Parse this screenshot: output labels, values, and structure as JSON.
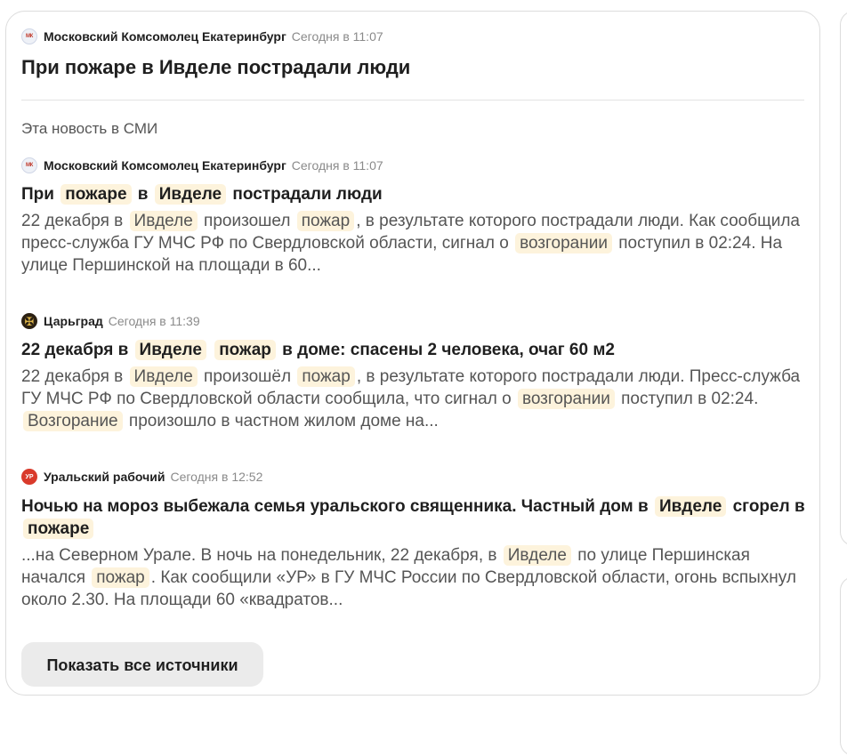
{
  "header": {
    "source_name": "Московский Комсомолец Екатеринбург",
    "time": "Сегодня в 11:07",
    "logo_text": "МК",
    "title": "При пожаре в Ивделе пострадали люди"
  },
  "section_label": "Эта новость в СМИ",
  "items": [
    {
      "source_name": "Московский Комсомолец Екатеринбург",
      "time": "Сегодня в 11:07",
      "logo_text": "МК",
      "title": [
        {
          "t": "При "
        },
        {
          "t": "пожаре",
          "hl": true
        },
        {
          "t": " в "
        },
        {
          "t": "Ивделе",
          "hl": true
        },
        {
          "t": " пострадали люди"
        }
      ],
      "snippet": [
        {
          "t": "22 декабря в "
        },
        {
          "t": "Ивделе",
          "hl": true
        },
        {
          "t": " произошел "
        },
        {
          "t": "пожар",
          "hl": true
        },
        {
          "t": ", в результате которого пострадали люди. Как сообщила пресс-служба ГУ МЧС РФ по Свердловской области, сигнал о "
        },
        {
          "t": "возгорании",
          "hl": true
        },
        {
          "t": " поступил в 02:24. На улице Першинской на площади в 60..."
        }
      ]
    },
    {
      "source_name": "Царьград",
      "time": "Сегодня в 11:39",
      "logo_text": "✠",
      "title": [
        {
          "t": "22 декабря в "
        },
        {
          "t": "Ивделе",
          "hl": true
        },
        {
          "t": " "
        },
        {
          "t": "пожар",
          "hl": true
        },
        {
          "t": " в доме: спасены 2 человека, очаг 60 м2"
        }
      ],
      "snippet": [
        {
          "t": "22 декабря в "
        },
        {
          "t": "Ивделе",
          "hl": true
        },
        {
          "t": " произошёл "
        },
        {
          "t": "пожар",
          "hl": true
        },
        {
          "t": ", в результате которого пострадали люди. Пресс-служба ГУ МЧС РФ по Свердловской области сообщила, что сигнал о "
        },
        {
          "t": "возгорании",
          "hl": true
        },
        {
          "t": " поступил в 02:24. "
        },
        {
          "t": "Возгорание",
          "hl": true
        },
        {
          "t": " произошло в частном жилом доме на..."
        }
      ]
    },
    {
      "source_name": "Уральский рабочий",
      "time": "Сегодня в 12:52",
      "logo_text": "УР",
      "title": [
        {
          "t": "Ночью на мороз выбежала семья уральского священника. Частный дом в "
        },
        {
          "t": "Ивделе",
          "hl": true
        },
        {
          "t": " сгорел в "
        },
        {
          "t": "пожаре",
          "hl": true
        }
      ],
      "snippet": [
        {
          "t": "...на Северном Урале. В ночь на понедельник, 22 декабря, в "
        },
        {
          "t": "Ивделе",
          "hl": true
        },
        {
          "t": " по улице Першинская начался "
        },
        {
          "t": "пожар",
          "hl": true
        },
        {
          "t": ". Как сообщили «УР» в ГУ МЧС России по Свердловской области, огонь вспыхнул около 2.30. На площади 60 «квадратов..."
        }
      ]
    }
  ],
  "show_all_button": "Показать все источники",
  "colors": {
    "highlight_bg": "#fdf3dc",
    "button_bg": "#ebebeb",
    "muted_text": "#8a8a8a",
    "snippet_text": "#555555"
  }
}
